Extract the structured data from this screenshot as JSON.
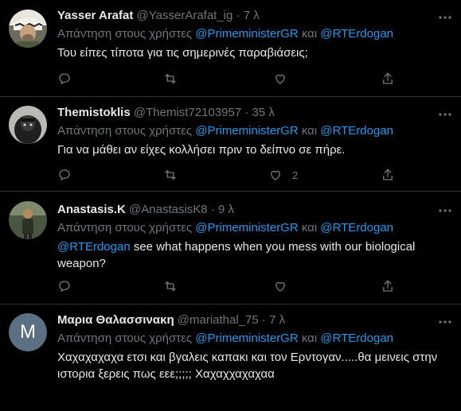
{
  "reply_prefix": "Απάντηση στους χρήστες",
  "reply_join": "και",
  "tweets": [
    {
      "name": "Yasser Arafat",
      "handle": "@YasserArafat_ig",
      "time": "7 λ",
      "mention1": "@PrimeministerGR",
      "mention2": "@RTErdogan",
      "text": "Του είπες τίποτα για τις σημερινές παραβιάσεις;",
      "like_count": ""
    },
    {
      "name": "Themistoklis",
      "handle": "@Themist72103957",
      "time": "35 λ",
      "mention1": "@PrimeministerGR",
      "mention2": "@RTErdogan",
      "text": "Για να μάθει αν είχες κολλήσει πριν το δείπνο σε πήρε.",
      "like_count": "2"
    },
    {
      "name": "Anastasis.K",
      "handle": "@AnastasisK8",
      "time": "9 λ",
      "mention1": "@PrimeministerGR",
      "mention2": "@RTErdogan",
      "text_mention": "@RTErdogan",
      "text": " see what happens when you mess with our biological weapon?",
      "like_count": ""
    },
    {
      "name": "Μαρια Θαλασσινακη",
      "handle": "@mariathal_75",
      "time": "7 λ",
      "mention1": "@PrimeministerGR",
      "mention2": "@RTErdogan",
      "avatar_letter": "M",
      "text": "Χαχαχαχαχα ετσι και βγαλεις καπακι και τον Ερντογαν.....θα μεινεις στην ιστορια ξερεις πως εεε;;;;; Χαχαχχαχαχαα"
    }
  ],
  "colors": {
    "background": "#000000",
    "text": "#e7e9ea",
    "muted": "#71767b",
    "link": "#1d9bf0",
    "divider": "#2f3336"
  }
}
